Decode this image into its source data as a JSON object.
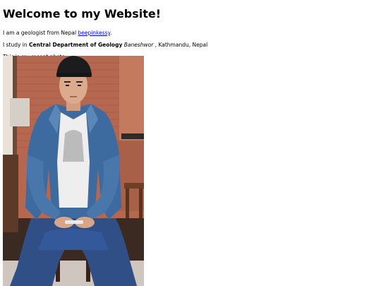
{
  "page": {
    "heading": "Welcome to my Website!",
    "intro": {
      "text": "I am a geologist from Nepal",
      "link_text": "beepinkessy",
      "trailing": "."
    },
    "study": {
      "prefix": "I study in",
      "department": "Central Department of Geology",
      "location": "Baneshwor",
      "suffix": ", Kathmandu, Nepal"
    },
    "photo_caption": "This is my recent photo:",
    "photo": {
      "subject": "young man in black cap and denim jacket seated indoors holding a phone",
      "background_color": "#b5684f",
      "jacket_color": "#3e6b9f"
    }
  }
}
